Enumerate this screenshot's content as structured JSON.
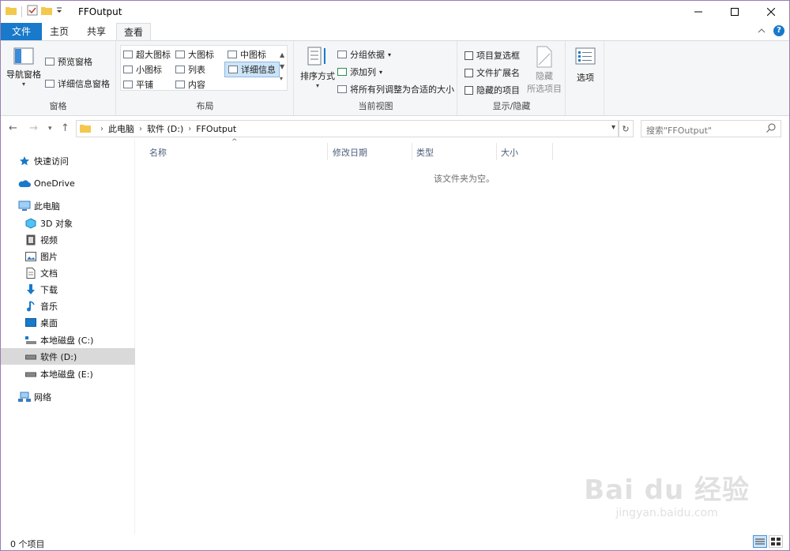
{
  "window": {
    "title": "FFOutput",
    "controls": [
      "minimize",
      "maximize",
      "close"
    ]
  },
  "tabs": [
    {
      "label": "文件"
    },
    {
      "label": "主页"
    },
    {
      "label": "共享"
    },
    {
      "label": "查看"
    }
  ],
  "ribbon": {
    "panes": {
      "label": "窗格",
      "nav_pane": "导航窗格",
      "preview_pane": "预览窗格",
      "details_pane": "详细信息窗格"
    },
    "layout": {
      "label": "布局",
      "items": [
        "超大图标",
        "大图标",
        "中图标",
        "小图标",
        "列表",
        "详细信息",
        "平铺",
        "内容"
      ]
    },
    "current_view": {
      "label": "当前视图",
      "sort_by": "排序方式",
      "group_by": "分组依据",
      "add_columns": "添加列",
      "size_all_columns": "将所有列调整为合适的大小"
    },
    "show_hide": {
      "label": "显示/隐藏",
      "item_checkboxes": "项目复选框",
      "file_extensions": "文件扩展名",
      "hidden_items": "隐藏的项目",
      "hide_selected_1": "隐藏",
      "hide_selected_2": "所选项目"
    },
    "options": "选项"
  },
  "address": {
    "crumbs": [
      "此电脑",
      "软件 (D:)",
      "FFOutput"
    ],
    "search_placeholder": "搜索\"FFOutput\""
  },
  "nav": {
    "quick_access": "快速访问",
    "onedrive": "OneDrive",
    "this_pc": "此电脑",
    "pc_items": [
      "3D 对象",
      "视频",
      "图片",
      "文档",
      "下载",
      "音乐",
      "桌面",
      "本地磁盘 (C:)",
      "软件 (D:)",
      "本地磁盘 (E:)"
    ],
    "network": "网络"
  },
  "columns": [
    "名称",
    "修改日期",
    "类型",
    "大小"
  ],
  "empty_message": "该文件夹为空。",
  "status": {
    "item_count": "0 个项目"
  },
  "watermark": {
    "logo": "Bai du 经验",
    "url": "jingyan.baidu.com"
  },
  "colors": {
    "accent": "#1979ca",
    "selected_nav": "#d9d9d9",
    "ribbon_bg": "#f5f6f7"
  }
}
